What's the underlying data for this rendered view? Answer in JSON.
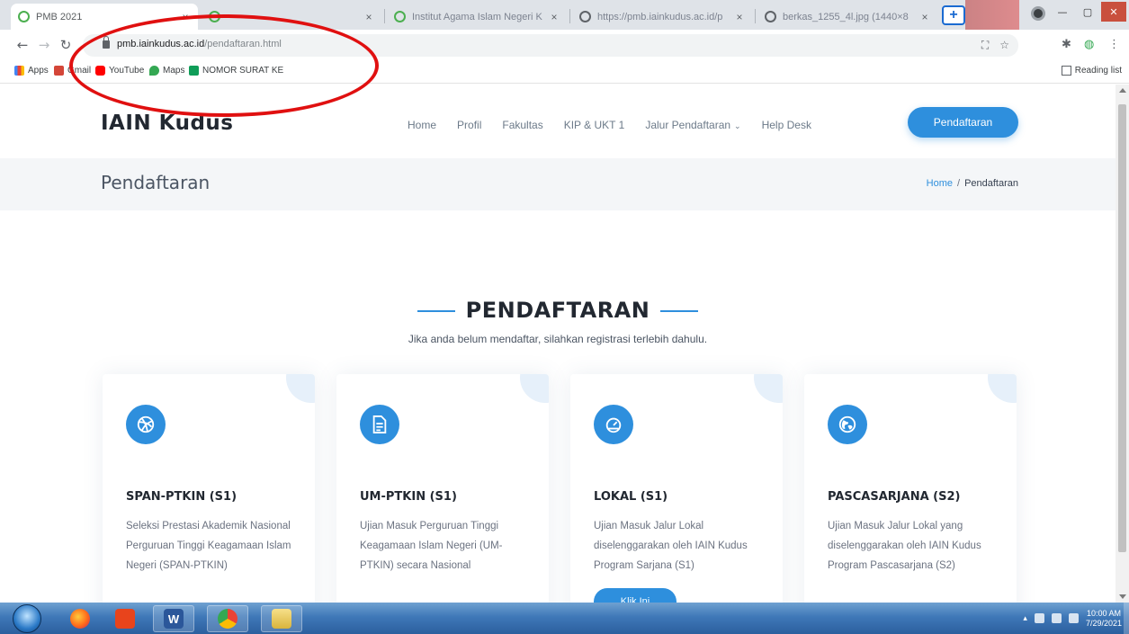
{
  "browser": {
    "tabs": [
      {
        "title": "PMB 2021",
        "icon": "leaf-icon"
      },
      {
        "title": "",
        "icon": "leaf-icon"
      },
      {
        "title": "Institut Agama Islam Negeri K",
        "icon": "leaf-icon"
      },
      {
        "title": "https://pmb.iainkudus.ac.id/p",
        "icon": "globe-icon"
      },
      {
        "title": "berkas_1255_4l.jpg (1440×8",
        "icon": "globe-icon"
      }
    ],
    "tab_close": "×",
    "new_tab": "+",
    "url_host": "pmb.iainkudus.ac.id",
    "url_path": "/pendaftaran.html",
    "bookmarks": [
      {
        "label": "Apps",
        "color": "#4285f4"
      },
      {
        "label": "Gmail",
        "color": "#d44638"
      },
      {
        "label": "YouTube",
        "color": "#ff0000"
      },
      {
        "label": "Maps",
        "color": "#34a853"
      },
      {
        "label": "NOMOR SURAT KE",
        "color": "#0f9d58"
      }
    ],
    "reading_list": "Reading list"
  },
  "site": {
    "brand": "IAIN Kudus",
    "nav": [
      "Home",
      "Profil",
      "Fakultas",
      "KIP & UKT 1",
      "Jalur Pendaftaran",
      "Help Desk"
    ],
    "nav_dropdown_caret": "⌄",
    "cta": "Pendaftaran",
    "page_title": "Pendaftaran",
    "breadcrumb": {
      "home": "Home",
      "sep": "/",
      "current": "Pendaftaran"
    },
    "accent": "#2e8fdd"
  },
  "section": {
    "title": "PENDAFTARAN",
    "subtitle": "Jika anda belum mendaftar, silahkan registrasi terlebih dahulu."
  },
  "cards": [
    {
      "title": "SPAN-PTKIN (S1)",
      "desc": "Seleksi Prestasi Akademik Nasional Perguruan Tinggi Keagamaan Islam Negeri (SPAN-PTKIN)",
      "icon": "dribbble-icon"
    },
    {
      "title": "UM-PTKIN (S1)",
      "desc": "Ujian Masuk Perguruan Tinggi Keagamaan Islam Negeri (UM-PTKIN) secara Nasional",
      "icon": "document-icon"
    },
    {
      "title": "LOKAL (S1)",
      "desc": "Ujian Masuk Jalur Lokal diselenggarakan oleh IAIN Kudus Program Sarjana (S1)",
      "icon": "speedometer-icon",
      "button": "Klik Ini"
    },
    {
      "title": "PASCASARJANA (S2)",
      "desc": "Ujian Masuk Jalur Lokal yang diselenggarakan oleh IAIN Kudus Program Pascasarjana (S2)",
      "icon": "globe-icon"
    }
  ],
  "taskbar": {
    "time": "10:00 AM",
    "date": "7/29/2021"
  }
}
